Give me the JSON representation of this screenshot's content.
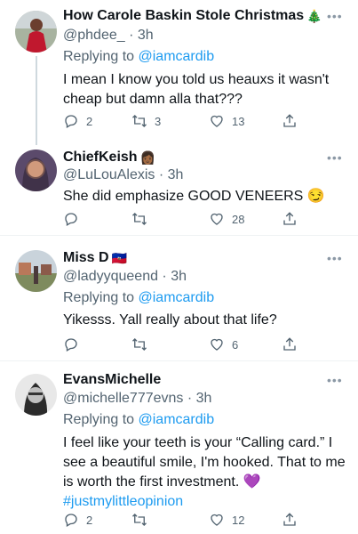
{
  "tweets": [
    {
      "display_name": "How Carole Baskin Stole Christmas",
      "name_emoji": "🎄",
      "handle_line": "@phdee_ · 3h",
      "replying_prefix": "Replying to ",
      "replying_to": "@iamcardib",
      "text": "I mean I know you told us heauxs it wasn't cheap but damn alla that???",
      "replies": "2",
      "retweets": "3",
      "likes": "13",
      "more_icon": "ellipsis-icon"
    },
    {
      "display_name": "ChiefKeish",
      "name_emoji": "👩🏾",
      "handle_line": "@LuLouAlexis · 3h",
      "text": "She did emphasize GOOD VENEERS",
      "text_emoji": "😏",
      "replies": "",
      "retweets": "",
      "likes": "28"
    },
    {
      "display_name": "Miss D",
      "name_emoji": "🇭🇹",
      "handle_line": "@ladyyqueend · 3h",
      "replying_prefix": "Replying to ",
      "replying_to": "@iamcardib",
      "text": "Yikesss. Yall really about that life?",
      "replies": "",
      "retweets": "",
      "likes": "6"
    },
    {
      "display_name": "EvansMichelle",
      "handle_line": "@michelle777evns · 3h",
      "replying_prefix": "Replying to ",
      "replying_to": "@iamcardib",
      "text": "I feel like your teeth is your “Calling card.” I see a beautiful smile, I'm hooked. That to me is worth the first investment.",
      "text_emoji": "💜",
      "hashtag": "#justmylittleopinion",
      "replies": "2",
      "retweets": "",
      "likes": "12"
    }
  ],
  "colors": {
    "link": "#1d9bf0",
    "muted": "#536471",
    "text": "#0f1419"
  }
}
